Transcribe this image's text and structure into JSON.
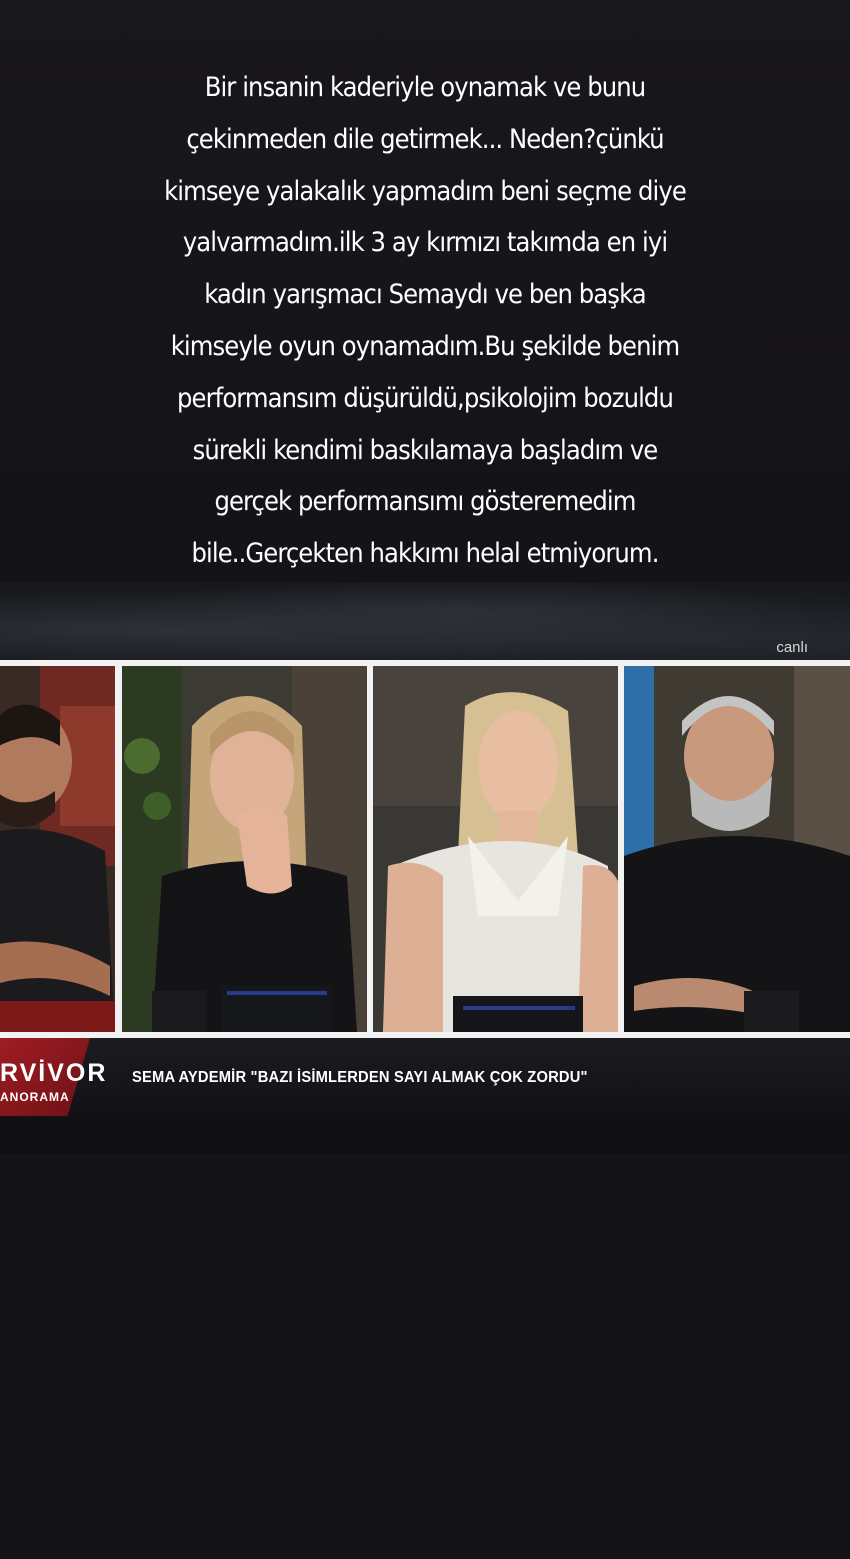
{
  "story": {
    "caption_lines": [
      "Bir insanin kaderiyle oynamak ve bunu",
      "çekinmeden dile getirmek... Neden?çünkü",
      "kimseye yalakalık yapmadım beni seçme diye",
      "yalvarmadım.ilk 3 ay kırmızı takımda en iyi",
      "kadın yarışmacı Semaydı ve ben başka",
      "kimseyle oyun oynamadım.Bu şekilde benim",
      "performansım düşürüldü,psikolojim bozuldu",
      "sürekli kendimi baskılamaya başladım ve",
      "gerçek performansımı gösteremedim",
      "bile..Gerçekten hakkımı helal etmiyorum."
    ]
  },
  "video": {
    "live_label": "canlı",
    "show_logo": "RVİVOR",
    "show_subtitle": "ANORAMA",
    "headline": "SEMA AYDEMİR \"BAZI İSİMLERDEN SAYI ALMAK ÇOK ZORDU\"",
    "colors": {
      "brand_red": "#b71d24",
      "lower_third_bg": "#17161a"
    }
  }
}
